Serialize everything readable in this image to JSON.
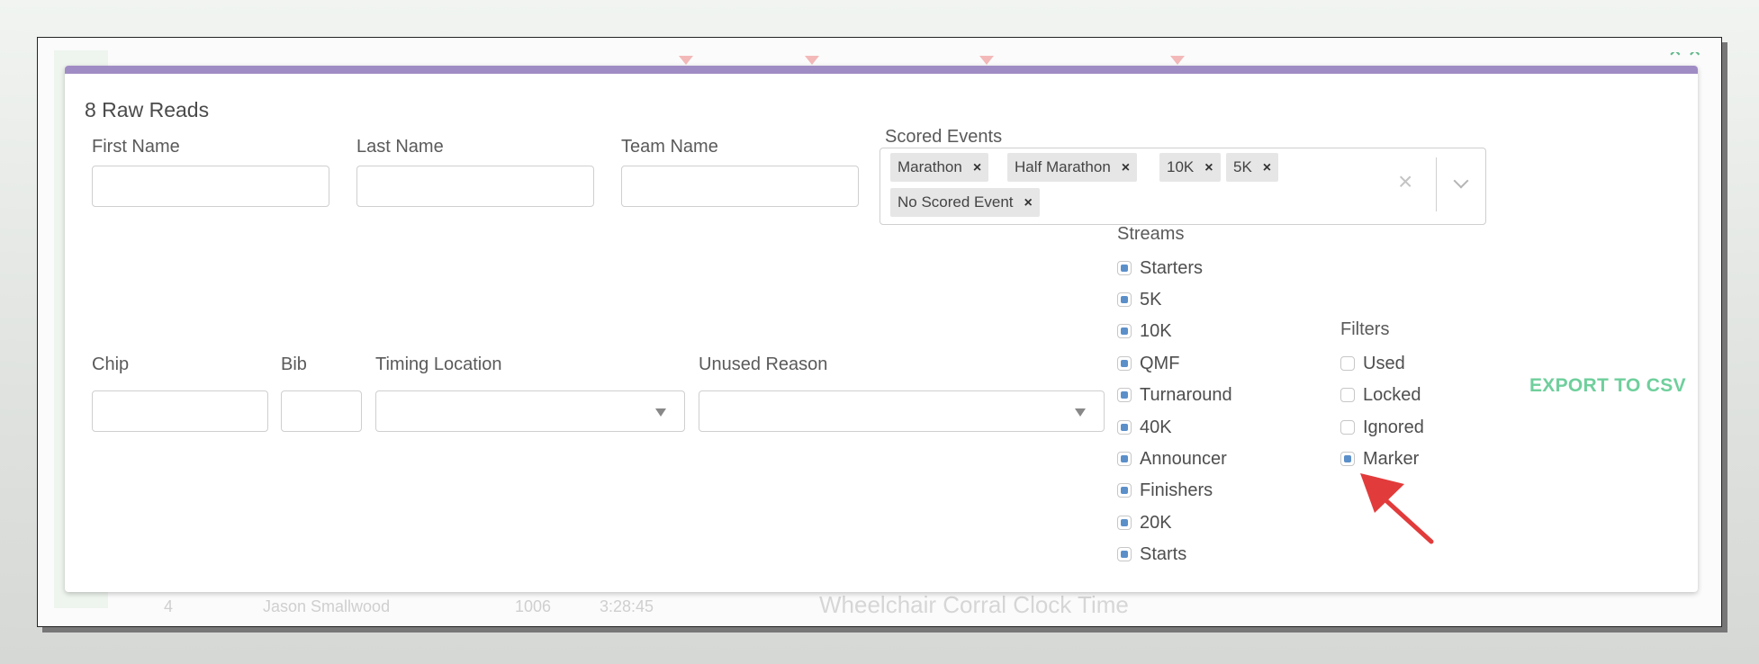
{
  "background": {
    "bottom_row": [
      "4",
      "Jason Smallwood",
      "1006",
      "3:28:45"
    ],
    "bottom_title": "Wheelchair Corral Clock Time"
  },
  "modal": {
    "title": "8 Raw Reads",
    "accent_color": "#a08cc4",
    "first_name": {
      "label": "First Name",
      "value": ""
    },
    "last_name": {
      "label": "Last Name",
      "value": ""
    },
    "team_name": {
      "label": "Team Name",
      "value": ""
    },
    "scored_events": {
      "label": "Scored Events",
      "selected": [
        "Marathon",
        "Half Marathon",
        "10K",
        "5K",
        "No Scored Event"
      ],
      "remove_icon": "close-icon",
      "clear_icon": "clear-icon",
      "dropdown_icon": "chevron-down-icon"
    },
    "chip": {
      "label": "Chip",
      "value": ""
    },
    "bib": {
      "label": "Bib",
      "value": ""
    },
    "timing_location": {
      "label": "Timing Location",
      "value": ""
    },
    "unused_reason": {
      "label": "Unused Reason",
      "value": ""
    },
    "streams": {
      "label": "Streams",
      "items": [
        {
          "label": "Starters",
          "checked": true
        },
        {
          "label": "5K",
          "checked": true
        },
        {
          "label": "10K",
          "checked": true
        },
        {
          "label": "QMF",
          "checked": true
        },
        {
          "label": "Turnaround",
          "checked": true
        },
        {
          "label": "40K",
          "checked": true
        },
        {
          "label": "Announcer",
          "checked": true
        },
        {
          "label": "Finishers",
          "checked": true
        },
        {
          "label": "20K",
          "checked": true
        },
        {
          "label": "Starts",
          "checked": true
        }
      ]
    },
    "filters": {
      "label": "Filters",
      "items": [
        {
          "label": "Used",
          "checked": false
        },
        {
          "label": "Locked",
          "checked": false
        },
        {
          "label": "Ignored",
          "checked": false
        },
        {
          "label": "Marker",
          "checked": true
        }
      ]
    },
    "export_label": "EXPORT TO CSV",
    "export_color": "#6fcf9c",
    "checkbox_color": "#5b8fc9",
    "annotation_arrow_color": "#e23b3b"
  }
}
